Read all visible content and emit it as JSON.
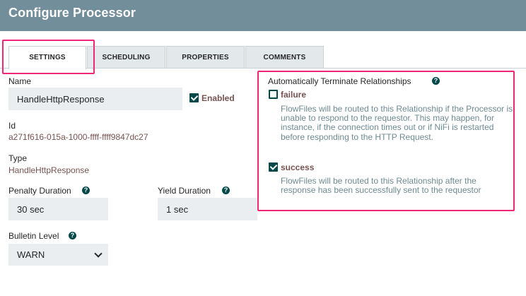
{
  "header": {
    "title": "Configure Processor"
  },
  "tabs": [
    {
      "label": "SETTINGS",
      "active": true
    },
    {
      "label": "SCHEDULING",
      "active": false
    },
    {
      "label": "PROPERTIES",
      "active": false
    },
    {
      "label": "COMMENTS",
      "active": false
    }
  ],
  "settings": {
    "name_label": "Name",
    "name_value": "HandleHttpResponse",
    "enabled_label": "Enabled",
    "enabled": true,
    "id_label": "Id",
    "id_value": "a271f616-015a-1000-ffff-ffff9847dc27",
    "type_label": "Type",
    "type_value": "HandleHttpResponse",
    "penalty_label": "Penalty Duration",
    "penalty_value": "30 sec",
    "yield_label": "Yield Duration",
    "yield_value": "1 sec",
    "bulletin_label": "Bulletin Level",
    "bulletin_value": "WARN"
  },
  "relationships": {
    "title": "Automatically Terminate Relationships",
    "items": [
      {
        "name": "failure",
        "checked": false,
        "description": "FlowFiles will be routed to this Relationship if the Processor is unable to respond to the requestor. This may happen, for instance, if the connection times out or if NiFi is restarted before responding to the HTTP Request."
      },
      {
        "name": "success",
        "checked": true,
        "description": "FlowFiles will be routed to this Relationship after the response has been successfully sent to the requestor"
      }
    ]
  },
  "icons": {
    "help": "?",
    "help_icon": "question-circle-icon",
    "dropdown_icon": "chevron-down-icon"
  },
  "colors": {
    "header": "#728e9b",
    "accent": "#004849",
    "value": "#775351",
    "description": "#6d8a93",
    "highlight": "#f0267a"
  }
}
